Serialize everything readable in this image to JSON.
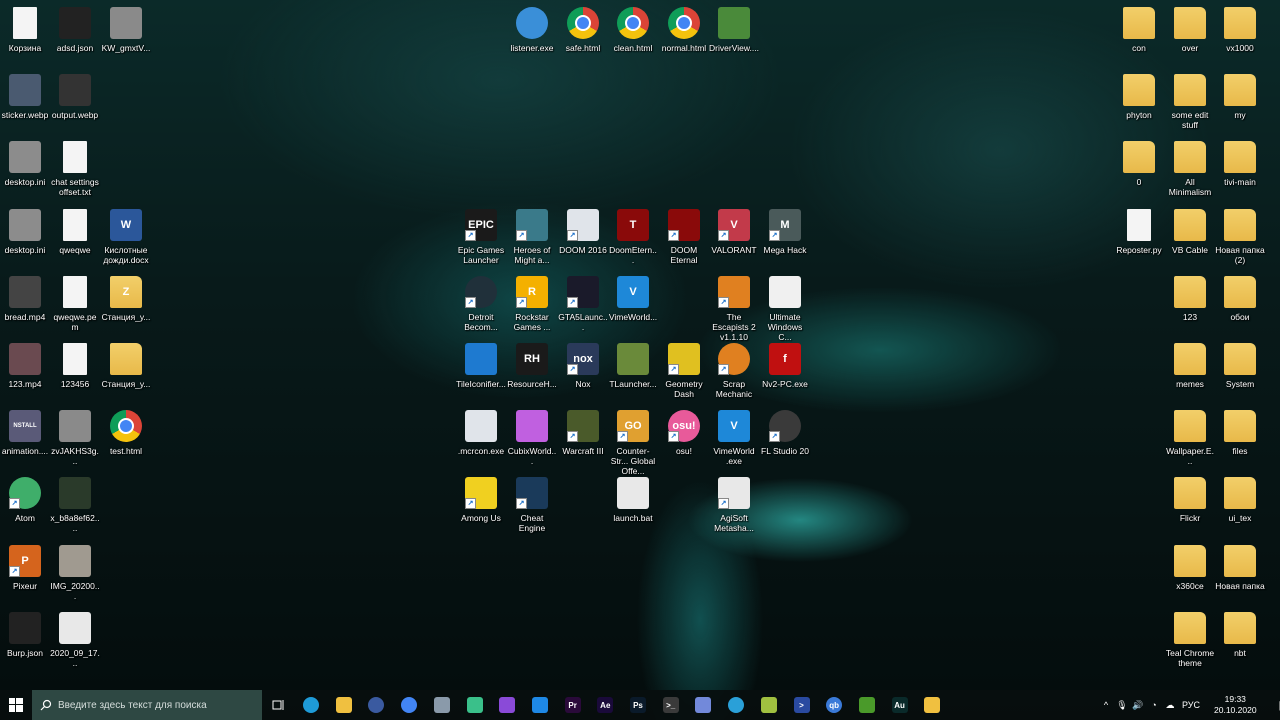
{
  "desktop": {
    "left_grid": [
      [
        {
          "label": "Корзина",
          "icon": "recycle-bin",
          "type": "file",
          "color": "#cfe0f0"
        },
        {
          "label": "adsd.json",
          "icon": "json-file",
          "type": "box",
          "color": "#222222"
        },
        {
          "label": "KW_gmxtV...",
          "icon": "image-file",
          "type": "box",
          "color": "#8a8a8a"
        }
      ],
      [
        {
          "label": "sticker.webp",
          "icon": "image-file",
          "type": "box",
          "color": "#4a5a70"
        },
        {
          "label": "output.webp",
          "icon": "image-file",
          "type": "box",
          "color": "#333333"
        },
        null
      ],
      [
        {
          "label": "desktop.ini",
          "icon": "settings-file",
          "type": "box",
          "color": "#8c8c8c"
        },
        {
          "label": "chat settings offset.txt",
          "icon": "text-file",
          "type": "file",
          "color": "#f4f4f4"
        },
        null
      ],
      [
        {
          "label": "desktop.ini",
          "icon": "settings-file",
          "type": "box",
          "color": "#8c8c8c"
        },
        {
          "label": "qweqwe",
          "icon": "file",
          "type": "file",
          "color": "#f4f4f4"
        },
        {
          "label": "Кислотные дожди.docx",
          "icon": "word-file",
          "type": "box",
          "color": "#2b579a",
          "glyph": "W"
        }
      ],
      [
        {
          "label": "bread.mp4",
          "icon": "video-file",
          "type": "box",
          "color": "#444444"
        },
        {
          "label": "qweqwe.pem",
          "icon": "file",
          "type": "file",
          "color": "#f4f4f4"
        },
        {
          "label": "Станция_у...",
          "icon": "folder",
          "type": "folder",
          "color": "#e8b94a",
          "glyph": "Z"
        }
      ],
      [
        {
          "label": "123.mp4",
          "icon": "video-file",
          "type": "box",
          "color": "#6a4a50"
        },
        {
          "label": "123456",
          "icon": "file",
          "type": "file",
          "color": "#f4f4f4"
        },
        {
          "label": "Станция_у...",
          "icon": "folder",
          "type": "folder",
          "color": "#e8b94a"
        }
      ],
      [
        {
          "label": "animation....",
          "icon": "video-file",
          "type": "box",
          "color": "#5a5a78",
          "glyph": "NSTALL"
        },
        {
          "label": "zvJAKHS3g...",
          "icon": "image-file",
          "type": "box",
          "color": "#8a8a8a"
        },
        {
          "label": "test.html",
          "icon": "chrome-icon",
          "type": "chrome",
          "color": "#4285f4"
        }
      ],
      [
        {
          "label": "Atom",
          "icon": "atom-app",
          "type": "round",
          "color": "#3fae6a",
          "shortcut": true
        },
        {
          "label": "x_b8a8ef62....",
          "icon": "image-file",
          "type": "box",
          "color": "#2a3a2a"
        },
        null
      ],
      [
        {
          "label": "Pixeur",
          "icon": "pixeur-app",
          "type": "box",
          "color": "#d5641d",
          "glyph": "P",
          "shortcut": true
        },
        {
          "label": "IMG_20200...",
          "icon": "image-file",
          "type": "box",
          "color": "#a09a90"
        },
        null
      ],
      [
        {
          "label": "Burp.json",
          "icon": "json-file",
          "type": "box",
          "color": "#222222"
        },
        {
          "label": "2020_09_17...",
          "icon": "image-file",
          "type": "box",
          "color": "#e8e8e8"
        },
        null
      ]
    ],
    "top_row": [
      null,
      {
        "label": "listener.exe",
        "icon": "satellite-app",
        "type": "round",
        "color": "#3a8fd8"
      },
      {
        "label": "safe.html",
        "icon": "chrome-icon",
        "type": "chrome",
        "color": "#4285f4"
      },
      {
        "label": "clean.html",
        "icon": "chrome-icon",
        "type": "chrome",
        "color": "#4285f4"
      },
      {
        "label": "normal.html",
        "icon": "chrome-icon",
        "type": "chrome",
        "color": "#4285f4"
      },
      {
        "label": "DriverView....",
        "icon": "driverview-app",
        "type": "box",
        "color": "#4a8a3a"
      },
      null
    ],
    "center_grid": [
      [
        {
          "label": "Epic Games Launcher",
          "icon": "epic-games-app",
          "type": "box",
          "color": "#1a1a1a",
          "glyph": "EPIC",
          "shortcut": true
        },
        {
          "label": "Heroes of Might a...",
          "icon": "heroes-app",
          "type": "box",
          "color": "#3a7a8a",
          "shortcut": true
        },
        {
          "label": "DOOM 2016",
          "icon": "exe-app",
          "type": "box",
          "color": "#e0e4ea",
          "shortcut": true
        },
        {
          "label": "DoomEtern...",
          "icon": "doom-app",
          "type": "box",
          "color": "#8a0a0a",
          "glyph": "T"
        },
        {
          "label": "DOOM Eternal",
          "icon": "doom-app",
          "type": "box",
          "color": "#8a0a0a",
          "shortcut": true
        },
        {
          "label": "VALORANT",
          "icon": "valorant-app",
          "type": "box",
          "color": "#c23a4a",
          "glyph": "V",
          "shortcut": true
        },
        {
          "label": "Mega Hack",
          "icon": "megahack-app",
          "type": "box",
          "color": "#4a5a5a",
          "glyph": "M",
          "shortcut": true
        }
      ],
      [
        {
          "label": "Detroit Becom...",
          "icon": "detroit-app",
          "type": "round",
          "color": "#20303a",
          "shortcut": true
        },
        {
          "label": "Rockstar Games ...",
          "icon": "rockstar-app",
          "type": "box",
          "color": "#f4b000",
          "glyph": "R",
          "shortcut": true
        },
        {
          "label": "GTA5Launc...",
          "icon": "gta-app",
          "type": "box",
          "color": "#1a1a2a",
          "shortcut": true
        },
        {
          "label": "VimeWorld...",
          "icon": "vimeworld-app",
          "type": "box",
          "color": "#1e88d8",
          "glyph": "V"
        },
        null,
        {
          "label": "The Escapists 2 v1.1.10",
          "icon": "escapists-app",
          "type": "box",
          "color": "#e08020",
          "shortcut": true
        },
        {
          "label": "Ultimate Windows C...",
          "icon": "exe-app",
          "type": "box",
          "color": "#f0f0f0"
        }
      ],
      [
        {
          "label": "TileIconifier...",
          "icon": "tileiconifier-app",
          "type": "box",
          "color": "#1e7ad0"
        },
        {
          "label": "ResourceH...",
          "icon": "resourcehacker-app",
          "type": "box",
          "color": "#1a1a1a",
          "glyph": "RH"
        },
        {
          "label": "Nox",
          "icon": "nox-app",
          "type": "box",
          "color": "#2a3a5a",
          "glyph": "nox",
          "shortcut": true
        },
        {
          "label": "TLauncher...",
          "icon": "minecraft-app",
          "type": "box",
          "color": "#6a8a3a"
        },
        {
          "label": "Geometry Dash",
          "icon": "geometry-dash-app",
          "type": "box",
          "color": "#e0c020",
          "shortcut": true
        },
        {
          "label": "Scrap Mechanic",
          "icon": "scrap-mechanic-app",
          "type": "round",
          "color": "#e08020",
          "shortcut": true
        },
        {
          "label": "Nv2-PC.exe",
          "icon": "flash-app",
          "type": "box",
          "color": "#c01010",
          "glyph": "f"
        }
      ],
      [
        {
          "label": ".mcrcon.exe",
          "icon": "exe-app",
          "type": "box",
          "color": "#e0e4ea"
        },
        {
          "label": "CubixWorld...",
          "icon": "gem-app",
          "type": "box",
          "color": "#c060e0"
        },
        {
          "label": "Warcraft III",
          "icon": "warcraft-app",
          "type": "box",
          "color": "#4a5a2a",
          "shortcut": true
        },
        {
          "label": "Counter-Str... Global Offe...",
          "icon": "csgo-app",
          "type": "box",
          "color": "#e0a030",
          "glyph": "GO",
          "shortcut": true
        },
        {
          "label": "osu!",
          "icon": "osu-app",
          "type": "round",
          "color": "#e85a9a",
          "glyph": "osu!",
          "shortcut": true
        },
        {
          "label": "VimeWorld .exe",
          "icon": "vimeworld-app",
          "type": "box",
          "color": "#1e88d8",
          "glyph": "V"
        },
        {
          "label": "FL Studio 20",
          "icon": "fl-studio-app",
          "type": "round",
          "color": "#3a3a3a",
          "shortcut": true
        }
      ],
      [
        {
          "label": "Among Us",
          "icon": "among-us-app",
          "type": "box",
          "color": "#f0d020",
          "shortcut": true
        },
        {
          "label": "Cheat Engine",
          "icon": "cheat-engine-app",
          "type": "box",
          "color": "#1a3a5a",
          "shortcut": true
        },
        null,
        {
          "label": "launch.bat",
          "icon": "batch-file",
          "type": "box",
          "color": "#e8e8e8"
        },
        null,
        {
          "label": "AgiSoft Metasha...",
          "icon": "batch-file",
          "type": "box",
          "color": "#e8e8e8",
          "shortcut": true
        },
        null
      ]
    ],
    "right_grid": [
      [
        {
          "label": "con",
          "icon": "folder",
          "type": "folder",
          "color": "#e8b94a"
        },
        {
          "label": "over",
          "icon": "folder",
          "type": "folder",
          "color": "#e8b94a"
        },
        {
          "label": "vx1000",
          "icon": "folder",
          "type": "folder",
          "color": "#e8b94a"
        }
      ],
      [
        {
          "label": "phyton",
          "icon": "folder",
          "type": "folder",
          "color": "#e8b94a"
        },
        {
          "label": "some edit stuff",
          "icon": "folder",
          "type": "folder",
          "color": "#e8b94a"
        },
        {
          "label": "my",
          "icon": "folder",
          "type": "folder",
          "color": "#e8b94a"
        }
      ],
      [
        {
          "label": "0",
          "icon": "folder",
          "type": "folder",
          "color": "#e8b94a"
        },
        {
          "label": "All Minimalism",
          "icon": "folder",
          "type": "folder",
          "color": "#e8b94a"
        },
        {
          "label": "tivi-main",
          "icon": "folder",
          "type": "folder",
          "color": "#e8b94a"
        }
      ],
      [
        {
          "label": "Reposter.py",
          "icon": "python-file",
          "type": "file",
          "color": "#f4f4f4"
        },
        {
          "label": "VB Cable",
          "icon": "folder",
          "type": "folder",
          "color": "#e8b94a"
        },
        {
          "label": "Новая папка (2)",
          "icon": "folder",
          "type": "folder",
          "color": "#e8b94a"
        }
      ],
      [
        null,
        {
          "label": "123",
          "icon": "folder",
          "type": "folder",
          "color": "#e8b94a"
        },
        {
          "label": "обои",
          "icon": "folder",
          "type": "folder",
          "color": "#e8b94a"
        }
      ],
      [
        null,
        {
          "label": "memes",
          "icon": "folder",
          "type": "folder",
          "color": "#e8b94a"
        },
        {
          "label": "System",
          "icon": "folder",
          "type": "folder",
          "color": "#e8b94a"
        }
      ],
      [
        null,
        {
          "label": "Wallpaper.E...",
          "icon": "folder",
          "type": "folder",
          "color": "#e8b94a"
        },
        {
          "label": "files",
          "icon": "folder",
          "type": "folder",
          "color": "#e8b94a"
        }
      ],
      [
        null,
        {
          "label": "Flickr",
          "icon": "folder",
          "type": "folder",
          "color": "#e8b94a"
        },
        {
          "label": "ui_tex",
          "icon": "folder",
          "type": "folder",
          "color": "#e8b94a"
        }
      ],
      [
        null,
        {
          "label": "x360ce",
          "icon": "folder",
          "type": "folder",
          "color": "#e8b94a"
        },
        {
          "label": "Новая папка",
          "icon": "folder",
          "type": "folder",
          "color": "#e8b94a"
        }
      ],
      [
        null,
        {
          "label": "Teal Chrome theme",
          "icon": "folder",
          "type": "folder",
          "color": "#e8b94a"
        },
        {
          "label": "nbt",
          "icon": "folder",
          "type": "folder",
          "color": "#e8b94a"
        }
      ]
    ]
  },
  "taskbar": {
    "search_placeholder": "Введите здесь текст для поиска",
    "apps": [
      {
        "name": "edge",
        "color": "#1e9bd8"
      },
      {
        "name": "file-explorer",
        "color": "#f0c040"
      },
      {
        "name": "bitwarden",
        "color": "#3a5aa0"
      },
      {
        "name": "chrome",
        "color": "#4285f4"
      },
      {
        "name": "remote-desktop",
        "color": "#8a9aaa"
      },
      {
        "name": "gitkraken",
        "color": "#3ac08a"
      },
      {
        "name": "visual-studio",
        "color": "#8a4ad8"
      },
      {
        "name": "vscode",
        "color": "#1e88e5"
      },
      {
        "name": "premiere",
        "color": "#2a0a3a",
        "glyph": "Pr"
      },
      {
        "name": "after-effects",
        "color": "#1a0a3a",
        "glyph": "Ae"
      },
      {
        "name": "photoshop",
        "color": "#0a1a2a",
        "glyph": "Ps"
      },
      {
        "name": "terminal",
        "color": "#3a3a3a",
        "glyph": ">_"
      },
      {
        "name": "discord",
        "color": "#7289da"
      },
      {
        "name": "telegram",
        "color": "#2aa0d8"
      },
      {
        "name": "notepad",
        "color": "#a0c040"
      },
      {
        "name": "powershell",
        "color": "#2a4aa0",
        "glyph": ">"
      },
      {
        "name": "qbittorrent",
        "color": "#3a7ad8",
        "glyph": "qb"
      },
      {
        "name": "nvidia",
        "color": "#4a9a2a"
      },
      {
        "name": "audition",
        "color": "#0a2a2a",
        "glyph": "Au"
      },
      {
        "name": "onedrive-folder",
        "color": "#f0c040"
      }
    ],
    "tray": {
      "language": "РУС",
      "time": "19:33",
      "date": "20.10.2020"
    }
  }
}
